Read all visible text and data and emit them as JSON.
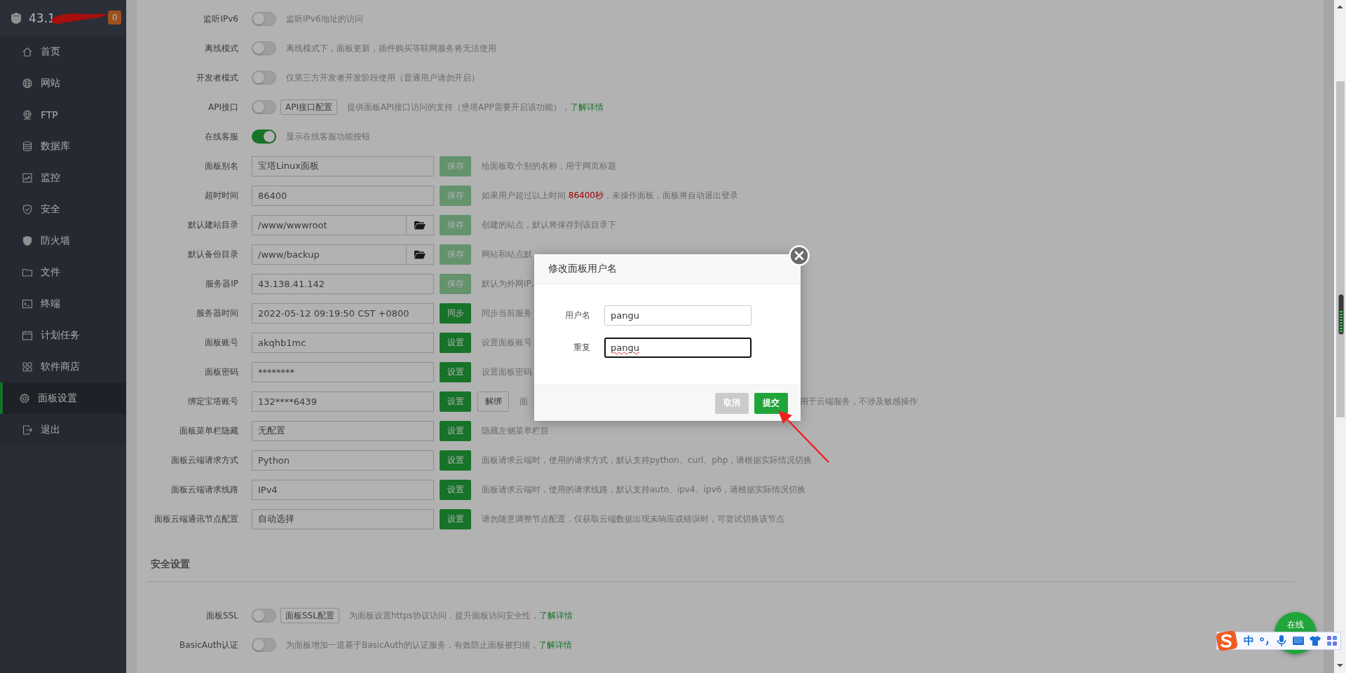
{
  "sidebar": {
    "host": "43.1",
    "badge": "0",
    "items": [
      {
        "label": "首页",
        "selected": false
      },
      {
        "label": "网站",
        "selected": false
      },
      {
        "label": "FTP",
        "selected": false
      },
      {
        "label": "数据库",
        "selected": false
      },
      {
        "label": "监控",
        "selected": false
      },
      {
        "label": "安全",
        "selected": false
      },
      {
        "label": "防火墙",
        "selected": false
      },
      {
        "label": "文件",
        "selected": false
      },
      {
        "label": "终端",
        "selected": false
      },
      {
        "label": "计划任务",
        "selected": false
      },
      {
        "label": "软件商店",
        "selected": false
      },
      {
        "label": "面板设置",
        "selected": true
      },
      {
        "label": "退出",
        "selected": false
      }
    ]
  },
  "settings": {
    "rows": [
      {
        "kind": "toggle",
        "label": "监听IPv6",
        "on": false,
        "description": "监听IPv6地址的访问"
      },
      {
        "kind": "toggle",
        "label": "离线模式",
        "on": false,
        "description": "离线模式下，面板更新，插件购买等联网服务将无法使用"
      },
      {
        "kind": "toggle",
        "label": "开发者模式",
        "on": false,
        "description": "仅第三方开发者开发阶段使用（普通用户请勿开启）"
      },
      {
        "kind": "toggle",
        "label": "API接口",
        "on": false,
        "config_button": "API接口配置",
        "description": "提供面板API接口访问的支持（堡塔APP需要开启该功能），",
        "link": "了解详情"
      },
      {
        "kind": "toggle",
        "label": "在线客服",
        "on": true,
        "description": "显示在线客服功能按钮"
      },
      {
        "kind": "input",
        "label": "面板别名",
        "value": "宝塔Linux面板",
        "button": {
          "label": "保存",
          "disabled": true
        },
        "description": "给面板取个别的名称，用于网页标题"
      },
      {
        "kind": "input",
        "label": "超时时间",
        "value": "86400",
        "button": {
          "label": "保存",
          "disabled": true
        },
        "description": "如果用户超过以上时间 ",
        "highlight": "86400秒",
        "description_end": "，未操作面板，面板将自动退出登录"
      },
      {
        "kind": "input",
        "label": "默认建站目录",
        "value": "/www/wwwroot",
        "browse": true,
        "button": {
          "label": "保存",
          "disabled": true
        },
        "description": "创建的站点，默认将保存到该目录下"
      },
      {
        "kind": "input",
        "label": "默认备份目录",
        "value": "/www/backup",
        "browse": true,
        "button": {
          "label": "保存",
          "disabled": true
        },
        "description": "网站和站点默"
      },
      {
        "kind": "input",
        "label": "服务器IP",
        "value": "43.138.41.142",
        "button": {
          "label": "保存",
          "disabled": true
        },
        "description": "默认为外网IP,"
      },
      {
        "kind": "input",
        "label": "服务器时间",
        "value": "2022-05-12 09:19:50 CST +0800",
        "button": {
          "label": "同步",
          "disabled": false
        },
        "description": "同步当前服务"
      },
      {
        "kind": "input",
        "label": "面板账号",
        "value": "akqhb1mc",
        "button": {
          "label": "设置",
          "disabled": false
        },
        "description": "设置面板账号"
      },
      {
        "kind": "input",
        "label": "面板密码",
        "value": "********",
        "button": {
          "label": "设置",
          "disabled": false
        },
        "description": "设置面板密码"
      },
      {
        "kind": "input",
        "label": "绑定宝塔账号",
        "value": "132****6439",
        "button": {
          "label": "设置",
          "disabled": false
        },
        "extra_button": "解绑",
        "description": "面",
        "description_after": "用于云端服务，不涉及敏感操作"
      },
      {
        "kind": "input",
        "label": "面板菜单栏隐藏",
        "value": "无配置",
        "button": {
          "label": "设置",
          "disabled": false
        },
        "description": "隐藏左侧菜单栏目"
      },
      {
        "kind": "input",
        "label": "面板云端请求方式",
        "value": "Python",
        "button": {
          "label": "设置",
          "disabled": false
        },
        "description": "面板请求云端时，使用的请求方式，默认支持python、curl、php，请根据实际情况切换"
      },
      {
        "kind": "input",
        "label": "面板云端请求线路",
        "value": "IPv4",
        "button": {
          "label": "设置",
          "disabled": false
        },
        "description": "面板请求云端时，使用的请求线路，默认支持auto、ipv4、ipv6，请根据实际情况切换"
      },
      {
        "kind": "input",
        "label": "面板云端通讯节点配置",
        "value": "自动选择",
        "button": {
          "label": "设置",
          "disabled": false
        },
        "description": "请勿随意调整节点配置，仅获取云端数据出现未响应或错误时，可尝试切换该节点"
      }
    ]
  },
  "security": {
    "title": "安全设置",
    "rows": [
      {
        "kind": "toggle",
        "label": "面板SSL",
        "on": false,
        "config_button": "面板SSL配置",
        "description": "为面板设置https协议访问，提升面板访问安全性，",
        "link": "了解详情"
      },
      {
        "kind": "toggle",
        "label": "BasicAuth认证",
        "on": false,
        "description": "为面板增加一道基于BasicAuth的认证服务，有效防止面板被扫描，",
        "link": "了解详情"
      }
    ]
  },
  "dialog": {
    "title": "修改面板用户名",
    "fields": [
      {
        "label": "用户名",
        "value": "pangu",
        "focused": false,
        "misspelled": false
      },
      {
        "label": "重复",
        "value": "pangu",
        "focused": true,
        "misspelled": true
      }
    ],
    "buttons": [
      {
        "label": "取消",
        "kind": "cancel"
      },
      {
        "label": "提交",
        "kind": "submit"
      }
    ]
  },
  "chat_button": {
    "label": "在线"
  },
  "ime_toolbar": {
    "mode": "中"
  }
}
